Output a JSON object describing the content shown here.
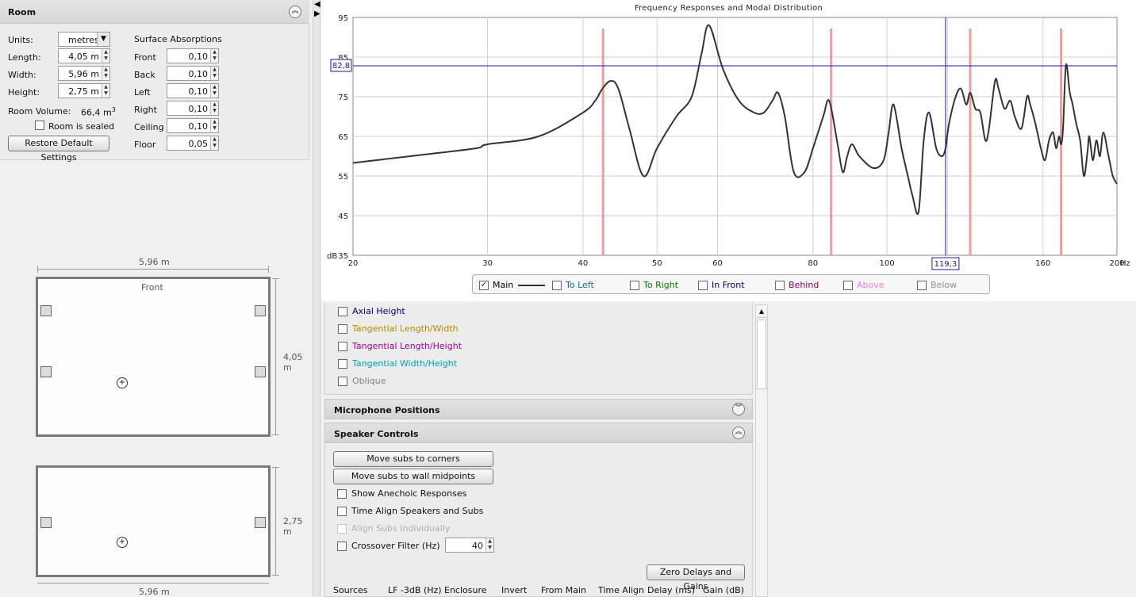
{
  "room": {
    "title": "Room",
    "units_label": "Units:",
    "units_value": "metres",
    "length_label": "Length:",
    "length_value": "4,05 m",
    "width_label": "Width:",
    "width_value": "5,96 m",
    "height_label": "Height:",
    "height_value": "2,75 m",
    "volume_label": "Room Volume:",
    "volume_value": "66,4 m",
    "volume_sup": "3",
    "sealed_label": "Room is sealed",
    "restore_label": "Restore Default Settings",
    "absorption_title": "Surface Absorptions",
    "absorptions": [
      {
        "label": "Front",
        "value": "0,10"
      },
      {
        "label": "Back",
        "value": "0,10"
      },
      {
        "label": "Left",
        "value": "0,10"
      },
      {
        "label": "Right",
        "value": "0,10"
      },
      {
        "label": "Ceiling",
        "value": "0,10"
      },
      {
        "label": "Floor",
        "value": "0,05"
      }
    ]
  },
  "plan": {
    "top_width": "5,96 m",
    "front_label": "Front",
    "top_depth": "4,05 m",
    "side_height": "2,75 m",
    "side_width": "5,96 m"
  },
  "chart": {
    "cursor_y_label": "82,8",
    "cursor_x_label": "119,3"
  },
  "chart_data": {
    "type": "line",
    "title": "Frequency Responses and Modal Distribution",
    "xlabel": "Hz",
    "ylabel": "dB",
    "x_scale": "log",
    "xlim": [
      20,
      200
    ],
    "ylim": [
      35,
      95
    ],
    "x_ticks": [
      "20",
      "30",
      "40",
      "50",
      "60",
      "80",
      "100",
      "120",
      "160",
      "200"
    ],
    "y_ticks": [
      "95",
      "85",
      "75",
      "65",
      "55",
      "45",
      "35"
    ],
    "grid": true,
    "series": [
      {
        "name": "Main",
        "x": [
          20,
          25,
          29,
          30,
          35,
          40,
          41.5,
          42.4,
          43.5,
          44.5,
          46,
          48,
          50,
          53,
          55.5,
          57.2,
          58.5,
          61,
          64,
          67,
          69,
          70.8,
          72,
          73.5,
          75.5,
          78,
          80,
          82.5,
          84,
          86,
          87.5,
          88.7,
          90,
          92,
          96,
          99,
          100.5,
          102,
          104.5,
          106.5,
          108,
          110,
          111.7,
          113.5,
          116,
          118,
          119.3,
          120.5,
          123,
          125,
          127,
          128.5,
          130.5,
          132.5,
          134.5,
          136,
          138.5,
          140,
          142.5,
          145,
          147,
          150,
          152.5,
          154,
          156.5,
          159,
          161,
          163,
          165,
          166.5,
          168,
          169,
          170,
          171.5,
          173.5,
          175,
          177,
          179,
          181,
          183,
          184,
          186,
          188,
          190,
          192,
          195,
          197.5,
          200
        ],
        "y": [
          58.3,
          60.5,
          62,
          63,
          65,
          71,
          74,
          77,
          79,
          77,
          67,
          55,
          62,
          70,
          75,
          86,
          93,
          82,
          74,
          71,
          71,
          74,
          76,
          70,
          56,
          56,
          62,
          70,
          74,
          64,
          56,
          60,
          63,
          60,
          57,
          59,
          66,
          73,
          62,
          55,
          50,
          46,
          64,
          71,
          62,
          60,
          62,
          68,
          75,
          77,
          73,
          76,
          72,
          71,
          64,
          67,
          79,
          77,
          72,
          74,
          70,
          67,
          75,
          73,
          68,
          62,
          59,
          64,
          66,
          62,
          65,
          63,
          67,
          83,
          76,
          73,
          68,
          64,
          55,
          61,
          65,
          59,
          64,
          60,
          66,
          60,
          55,
          53
        ]
      }
    ],
    "modal_lines_hz": [
      42.5,
      84.5,
      128.5,
      169
    ],
    "cursor": {
      "x": 119.3,
      "y": 82.8
    },
    "legend": [
      {
        "name": "Main",
        "checked": true,
        "color": "#000000"
      },
      {
        "name": "To Left",
        "checked": false,
        "color": "#007a7a"
      },
      {
        "name": "To Right",
        "checked": false,
        "color": "#007a00"
      },
      {
        "name": "In Front",
        "checked": false,
        "color": "#00007a"
      },
      {
        "name": "Behind",
        "checked": false,
        "color": "#7a007a"
      },
      {
        "name": "Above",
        "checked": false,
        "color": "#e080e0"
      },
      {
        "name": "Below",
        "checked": false,
        "color": "#909090"
      }
    ]
  },
  "modes": [
    {
      "label": "Axial Height",
      "color": "#000080"
    },
    {
      "label": "Tangential Length/Width",
      "color": "#b08a00"
    },
    {
      "label": "Tangential Length/Height",
      "color": "#a000a0"
    },
    {
      "label": "Tangential Width/Height",
      "color": "#00a0b0"
    },
    {
      "label": "Oblique",
      "color": "#808080"
    }
  ],
  "sections": {
    "mic_title": "Microphone Positions",
    "speaker_title": "Speaker Controls"
  },
  "speaker": {
    "move_corners": "Move subs to corners",
    "move_midpoints": "Move subs to wall midpoints",
    "show_anechoic": "Show Anechoic Responses",
    "time_align": "Time Align Speakers and Subs",
    "align_subs": "Align Subs Individually",
    "crossover_label": "Crossover Filter (Hz)",
    "crossover_value": "40",
    "zero_button": "Zero Delays and Gains",
    "columns": [
      "Sources",
      "LF -3dB (Hz)",
      "Enclosure",
      "Invert",
      "From Main",
      "Time Align",
      "Delay (ms)",
      "Gain (dB)"
    ]
  }
}
